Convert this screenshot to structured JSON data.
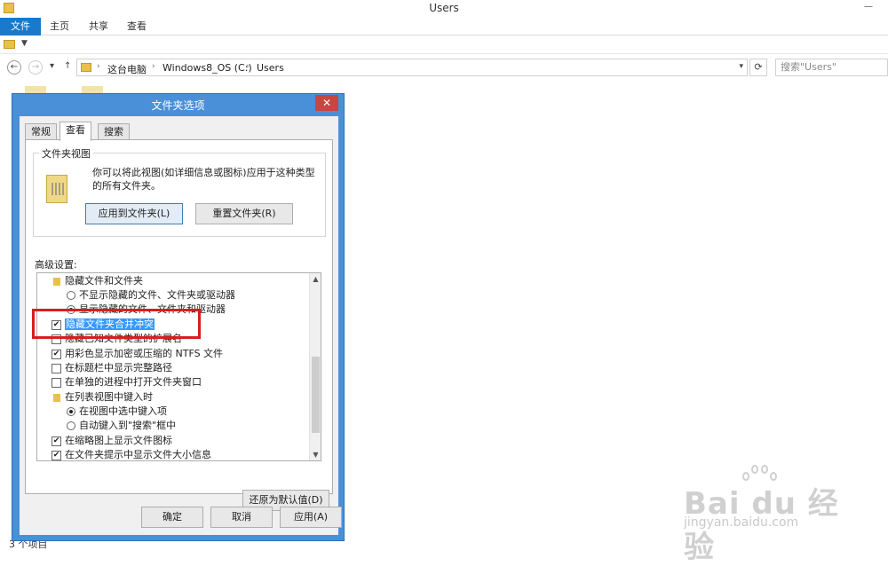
{
  "window": {
    "title": "Users"
  },
  "ribbon": {
    "tabs": [
      "文件",
      "主页",
      "共享",
      "查看"
    ]
  },
  "address": {
    "crumbs": [
      "这台电脑",
      "Windows8_OS (C:)",
      "Users"
    ],
    "search_placeholder": "搜索\"Users\""
  },
  "status": {
    "items_text": "3 个项目"
  },
  "dialog": {
    "title": "文件夹选项",
    "tabs": [
      "常规",
      "查看",
      "搜索"
    ],
    "folder_views": {
      "label": "文件夹视图",
      "desc": "你可以将此视图(如详细信息或图标)应用于这种类型的所有文件夹。",
      "apply_button": "应用到文件夹(L)",
      "reset_button": "重置文件夹(R)"
    },
    "advanced_label": "高级设置:",
    "tree_items": [
      {
        "type": "folder",
        "label": "隐藏文件和文件夹",
        "indent": 1
      },
      {
        "type": "radio",
        "checked": false,
        "label": "不显示隐藏的文件、文件夹或驱动器",
        "indent": 2
      },
      {
        "type": "radio",
        "checked": true,
        "label": "显示隐藏的文件、文件夹和驱动器",
        "indent": 2
      },
      {
        "type": "checkbox",
        "checked": true,
        "label": "隐藏文件夹合并冲突",
        "indent": 1,
        "selected": true
      },
      {
        "type": "checkbox",
        "checked": false,
        "label": "隐藏已知文件类型的扩展名",
        "indent": 1
      },
      {
        "type": "checkbox",
        "checked": true,
        "label": "用彩色显示加密或压缩的 NTFS 文件",
        "indent": 1
      },
      {
        "type": "checkbox",
        "checked": false,
        "label": "在标题栏中显示完整路径",
        "indent": 1
      },
      {
        "type": "checkbox",
        "checked": false,
        "label": "在单独的进程中打开文件夹窗口",
        "indent": 1
      },
      {
        "type": "folder",
        "label": "在列表视图中键入时",
        "indent": 1
      },
      {
        "type": "radio",
        "checked": true,
        "label": "在视图中选中键入项",
        "indent": 2
      },
      {
        "type": "radio",
        "checked": false,
        "label": "自动键入到\"搜索\"框中",
        "indent": 2
      },
      {
        "type": "checkbox",
        "checked": true,
        "label": "在缩略图上显示文件图标",
        "indent": 1
      },
      {
        "type": "checkbox",
        "checked": true,
        "label": "在文件夹提示中显示文件大小信息",
        "indent": 1
      }
    ],
    "restore_button": "还原为默认值(D)",
    "ok_button": "确定",
    "cancel_button": "取消",
    "apply_button": "应用(A)"
  },
  "watermark": {
    "brand": "Bai du 经验",
    "sub": "jingyan.baidu.com"
  },
  "colors": {
    "accent": "#1979ca",
    "dialog_frame": "#4a90d9",
    "highlight": "#3399ff",
    "annotation": "#d81e1e"
  }
}
